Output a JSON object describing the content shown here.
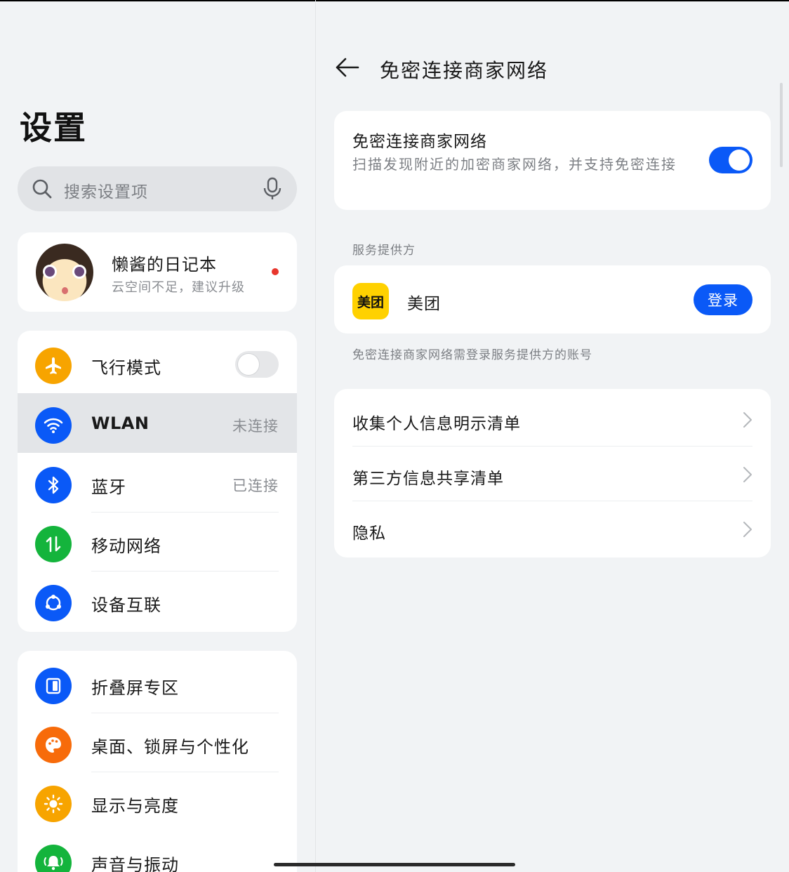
{
  "sidebar": {
    "title": "设置",
    "search": {
      "placeholder": "搜索设置项"
    },
    "account": {
      "name": "懒酱的日记本",
      "subtitle": "云空间不足，建议升级"
    },
    "group1": [
      {
        "label": "飞行模式",
        "icon": "airplane-icon",
        "color": "#f7a400",
        "toggle": "off"
      },
      {
        "label": "WLAN",
        "icon": "wifi-icon",
        "color": "#0a59f7",
        "status": "未连接",
        "selected": true
      },
      {
        "label": "蓝牙",
        "icon": "bluetooth-icon",
        "color": "#0a59f7",
        "status": "已连接"
      },
      {
        "label": "移动网络",
        "icon": "mobile-data-icon",
        "color": "#14b43c"
      },
      {
        "label": "设备互联",
        "icon": "device-connect-icon",
        "color": "#0a59f7"
      }
    ],
    "group2": [
      {
        "label": "折叠屏专区",
        "icon": "foldable-icon",
        "color": "#0a59f7"
      },
      {
        "label": "桌面、锁屏与个性化",
        "icon": "palette-icon",
        "color": "#f76b0a"
      },
      {
        "label": "显示与亮度",
        "icon": "brightness-icon",
        "color": "#f7a400"
      },
      {
        "label": "声音与振动",
        "icon": "bell-icon",
        "color": "#14b43c"
      }
    ]
  },
  "detail": {
    "title": "免密连接商家网络",
    "feature": {
      "title": "免密连接商家网络",
      "description": "扫描发现附近的加密商家网络，并支持免密连接",
      "toggle": "on"
    },
    "providers_label": "服务提供方",
    "provider": {
      "logo_text": "美团",
      "name": "美团",
      "login_label": "登录"
    },
    "provider_note": "免密连接商家网络需登录服务提供方的账号",
    "links": [
      {
        "label": "收集个人信息明示清单"
      },
      {
        "label": "第三方信息共享清单"
      },
      {
        "label": "隐私"
      }
    ]
  },
  "colors": {
    "accent": "#0a59f7",
    "background": "#f1f3f5",
    "card": "#ffffff",
    "meituan_yellow": "#ffd100"
  }
}
